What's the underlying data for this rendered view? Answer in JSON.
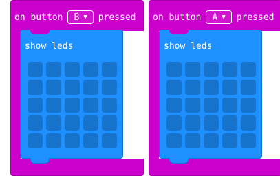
{
  "blocks": [
    {
      "on_label": "on button",
      "button_value": "B",
      "pressed_label": "pressed",
      "show_leds_label": "show leds"
    },
    {
      "on_label": "on button",
      "button_value": "A",
      "pressed_label": "pressed",
      "show_leds_label": "show leds"
    }
  ],
  "led_grid": {
    "rows": 5,
    "cols": 5,
    "lit": []
  },
  "colors": {
    "event_block": "#cc00cc",
    "basic_block": "#1e90ff",
    "led_off": "#1873cc"
  },
  "icons": {
    "dropdown": "caret-down-icon"
  }
}
